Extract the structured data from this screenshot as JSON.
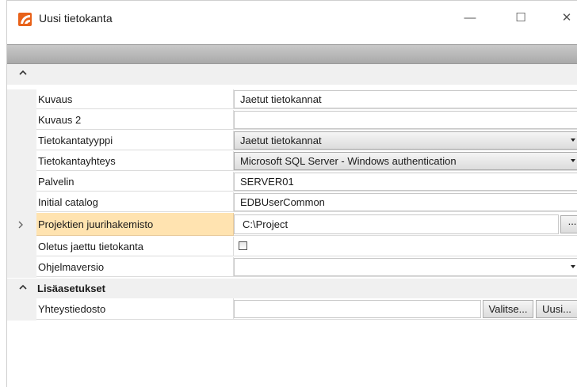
{
  "window": {
    "title": "Uusi tietokanta",
    "controls": {
      "minimize": "—",
      "maximize": "☐",
      "close": "✕"
    }
  },
  "colors": {
    "selected_row": "#ffe3b0",
    "app_icon": "#e8621a",
    "toolbar_strip": "#b8b8b8"
  },
  "grid": {
    "rows": [
      {
        "label": "Kuvaus",
        "value": "Jaetut tietokannat",
        "type": "text"
      },
      {
        "label": "Kuvaus 2",
        "value": "",
        "type": "text"
      },
      {
        "label": "Tietokantatyyppi",
        "value": "Jaetut tietokannat",
        "type": "combo"
      },
      {
        "label": "Tietokantayhteys",
        "value": "Microsoft SQL Server - Windows authentication",
        "type": "combo"
      },
      {
        "label": "Palvelin",
        "value": "SERVER01",
        "type": "text"
      },
      {
        "label": "Initial catalog",
        "value": "EDBUserCommon",
        "type": "text"
      },
      {
        "label": "Projektien juurihakemisto",
        "value": "C:\\Project",
        "type": "path",
        "browse": "...",
        "selected": true
      },
      {
        "label": "Oletus jaettu tietokanta",
        "value": "",
        "type": "checkbox",
        "checked": false
      },
      {
        "label": "Ohjelmaversio",
        "value": "",
        "type": "dropdown"
      }
    ],
    "category": {
      "label": "Lisäasetukset"
    },
    "extra_rows": [
      {
        "label": "Yhteystiedosto",
        "value": "",
        "buttons": [
          "Valitse...",
          "Uusi..."
        ]
      }
    ]
  }
}
